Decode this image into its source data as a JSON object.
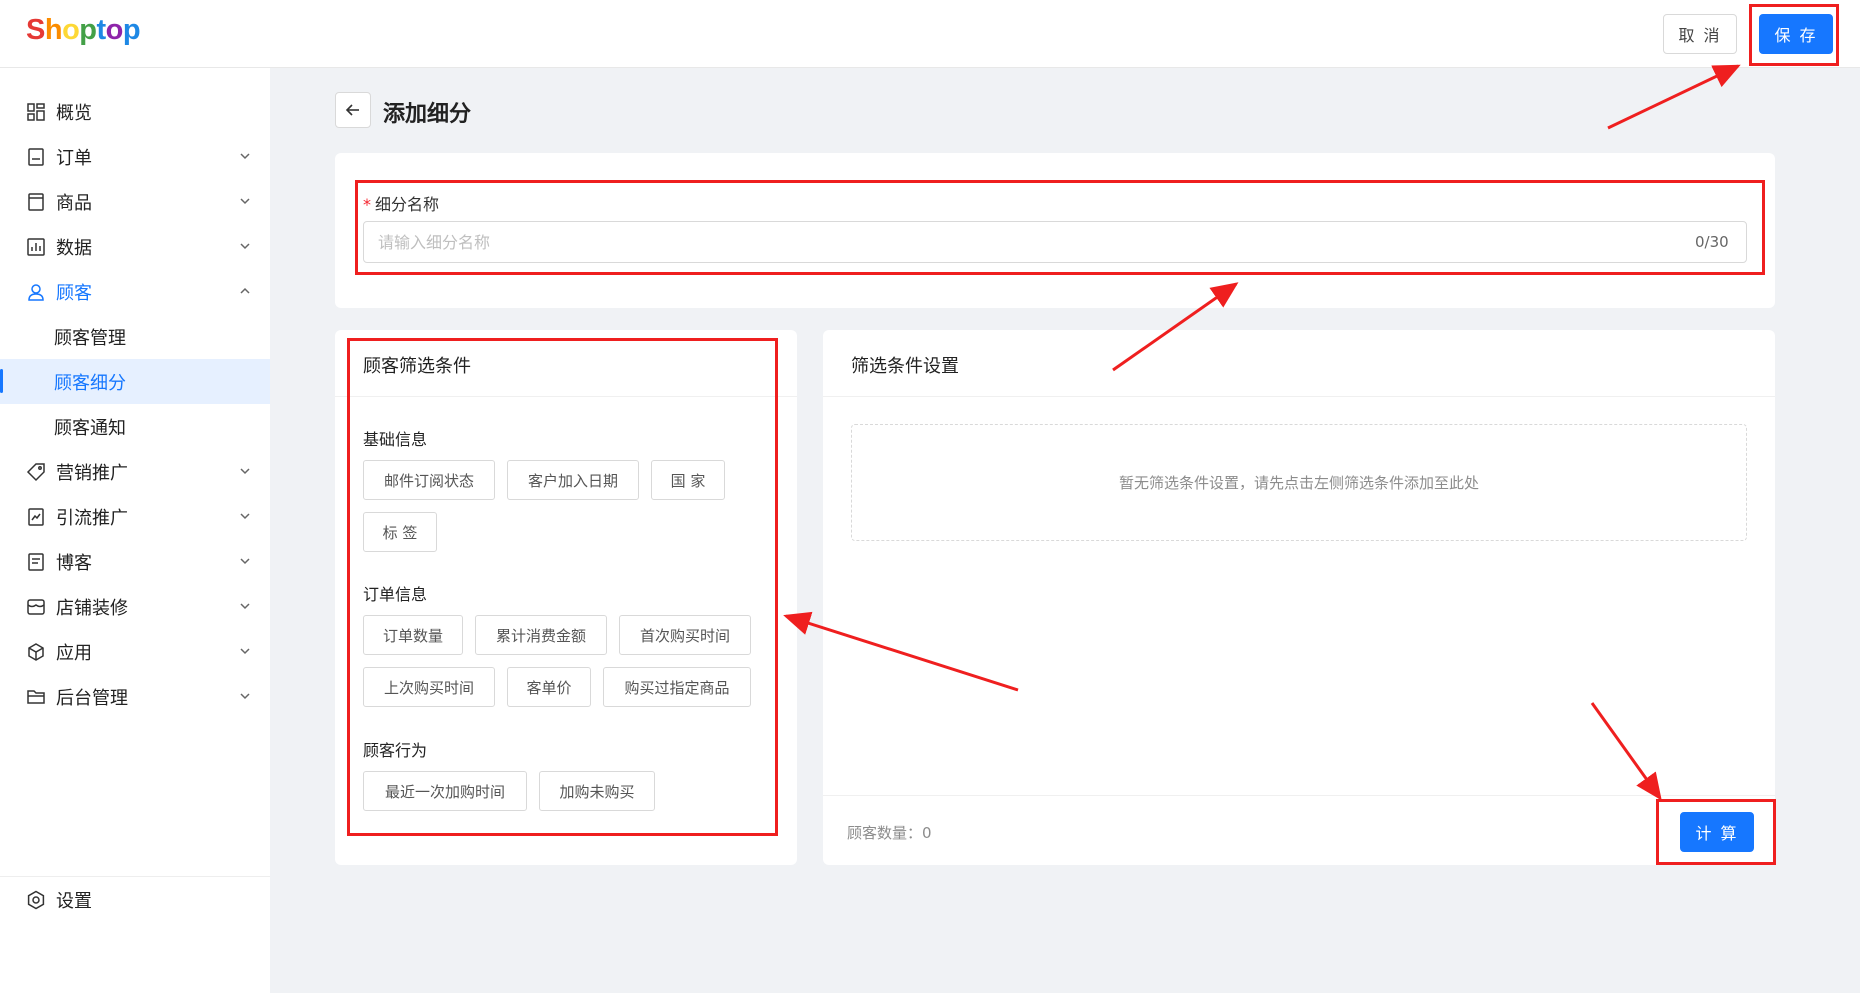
{
  "brand": {
    "logo_letters": [
      "S",
      "h",
      "o",
      "p",
      "t",
      "o",
      "p"
    ]
  },
  "header": {
    "cancel_label": "取 消",
    "save_label": "保 存"
  },
  "sidebar": {
    "items": [
      {
        "label": "概览",
        "icon": "dashboard-icon"
      },
      {
        "label": "订单",
        "icon": "order-icon"
      },
      {
        "label": "商品",
        "icon": "product-icon"
      },
      {
        "label": "数据",
        "icon": "chart-icon"
      },
      {
        "label": "顾客",
        "icon": "user-icon"
      },
      {
        "label": "顾客管理"
      },
      {
        "label": "顾客细分"
      },
      {
        "label": "顾客通知"
      },
      {
        "label": "营销推广",
        "icon": "tag-icon"
      },
      {
        "label": "引流推广",
        "icon": "traffic-icon"
      },
      {
        "label": "博客",
        "icon": "blog-icon"
      },
      {
        "label": "店铺装修",
        "icon": "store-icon"
      },
      {
        "label": "应用",
        "icon": "app-icon"
      },
      {
        "label": "后台管理",
        "icon": "folder-icon"
      }
    ],
    "settings_label": "设置"
  },
  "page": {
    "title": "添加细分"
  },
  "name_field": {
    "label": "细分名称",
    "required_mark": "*",
    "placeholder": "请输入细分名称",
    "counter": "0/30"
  },
  "filters": {
    "title": "顾客筛选条件",
    "groups": [
      {
        "title": "基础信息",
        "chips": [
          "邮件订阅状态",
          "客户加入日期",
          "国 家",
          "标 签"
        ]
      },
      {
        "title": "订单信息",
        "chips": [
          "订单数量",
          "累计消费金额",
          "首次购买时间",
          "上次购买时间",
          "客单价",
          "购买过指定商品"
        ]
      },
      {
        "title": "顾客行为",
        "chips": [
          "最近一次加购时间",
          "加购未购买"
        ]
      }
    ]
  },
  "settings": {
    "title": "筛选条件设置",
    "empty_text": "暂无筛选条件设置，请先点击左侧筛选条件添加至此处",
    "count_label": "顾客数量：0",
    "calc_label": "计 算"
  },
  "colors": {
    "primary": "#1677ff",
    "annotation": "#ef1f1f"
  }
}
